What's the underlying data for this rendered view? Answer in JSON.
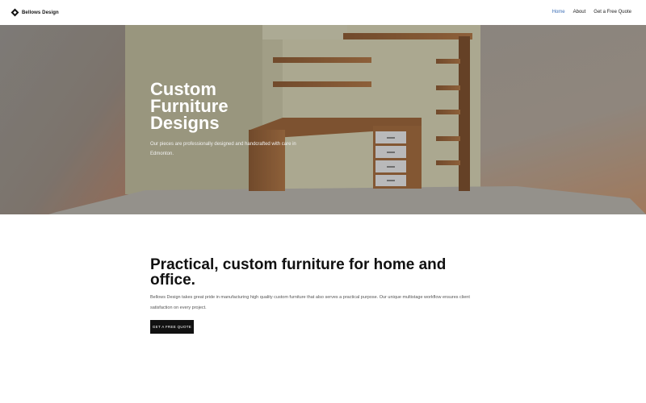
{
  "header": {
    "brand_name": "Bellows Design",
    "brand_icon": "diamond-logo-icon",
    "nav": [
      {
        "label": "Home",
        "active": true
      },
      {
        "label": "About",
        "active": false
      },
      {
        "label": "Get a Free Quote",
        "active": false
      }
    ]
  },
  "hero": {
    "title": "Custom Furniture Designs",
    "subtitle": "Our pieces are professionally designed and handcrafted with care in Edmonton."
  },
  "intro": {
    "title": "Practical, custom furniture for home and office.",
    "body": "Bellows Design takes great pride in manufacturing high quality custom furniture that also serves a practical purpose. Our unique multistage workflow ensures client satisfaction on every project.",
    "cta_label": "GET A FREE QUOTE"
  },
  "colors": {
    "accent": "#3d6fb6",
    "button_bg": "#111111"
  }
}
